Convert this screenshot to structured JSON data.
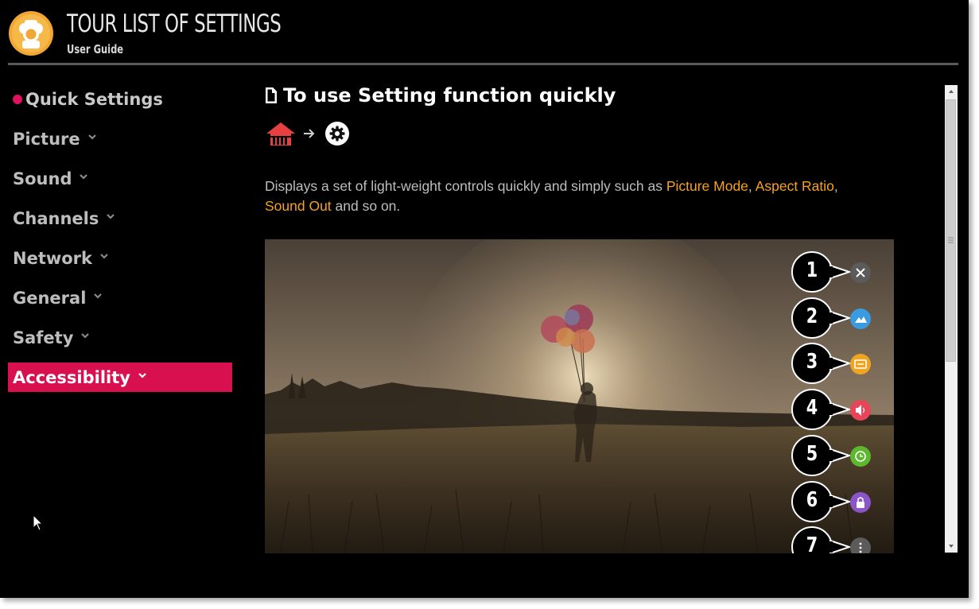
{
  "header": {
    "title": "TOUR LIST OF SETTINGS",
    "subtitle": "User Guide"
  },
  "sidebar": {
    "items": [
      {
        "label": "Quick Settings",
        "state": "current"
      },
      {
        "label": "Picture"
      },
      {
        "label": "Sound"
      },
      {
        "label": "Channels"
      },
      {
        "label": "Network"
      },
      {
        "label": "General"
      },
      {
        "label": "Safety"
      },
      {
        "label": "Accessibility",
        "state": "active"
      }
    ]
  },
  "main": {
    "heading": "To use Setting function quickly",
    "breadcrumb": {
      "icons": [
        "home-icon",
        "arrow-right-icon",
        "settings-gear-icon"
      ]
    },
    "description": {
      "text_before": "Displays a set of light-weight controls quickly and simply such as ",
      "link1": "Picture Mode",
      "sep1": ", ",
      "link2": "Aspect Ratio",
      "sep2": ",",
      "link3": "Sound Out",
      "text_after": " and so on."
    },
    "callouts": [
      {
        "number": "1",
        "icon": "close-icon",
        "color": "#5b5b5b"
      },
      {
        "number": "2",
        "icon": "picture-icon",
        "color": "#3a9be0"
      },
      {
        "number": "3",
        "icon": "aspect-ratio-icon",
        "color": "#f0a520"
      },
      {
        "number": "4",
        "icon": "speaker-icon",
        "color": "#e8445a"
      },
      {
        "number": "5",
        "icon": "timer-icon",
        "color": "#5cb82c"
      },
      {
        "number": "6",
        "icon": "lock-icon",
        "color": "#8a55c8"
      },
      {
        "number": "7",
        "icon": "more-icon",
        "color": "#5b5b5b"
      }
    ]
  },
  "colors": {
    "accent": "#d8104f",
    "highlight": "#f6a21c",
    "background": "#000000"
  }
}
